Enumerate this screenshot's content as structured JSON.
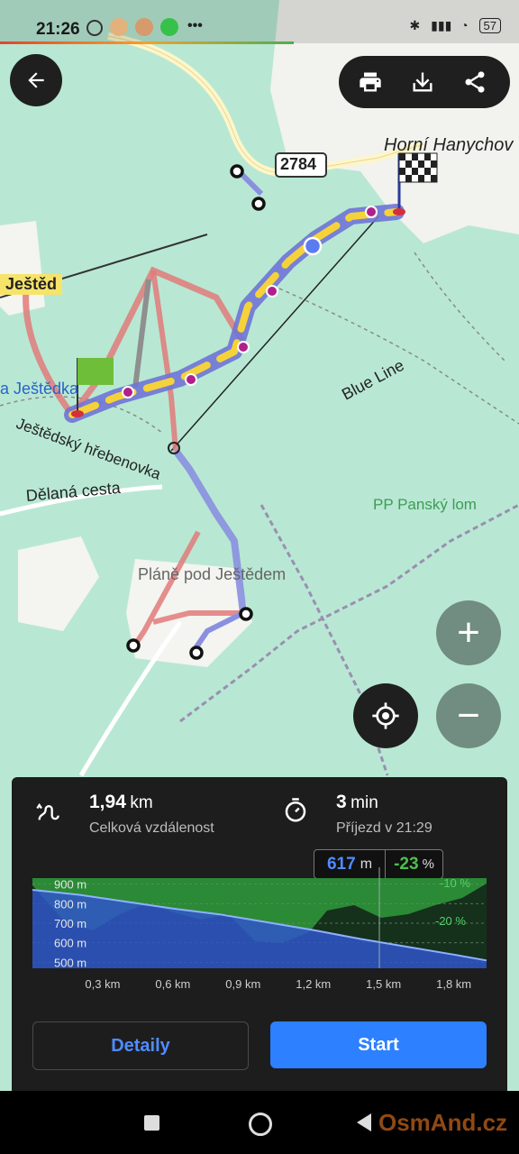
{
  "status_bar": {
    "time": "21:26",
    "more": "•••",
    "battery": "57"
  },
  "map": {
    "labels": {
      "town": "Horní Hanychov",
      "road_number": "2784",
      "peak": "Ještěd",
      "peak_hut": "a Ještědka",
      "ridge": "Ještědský hřebenovka",
      "cableway": "Blue Line",
      "road": "Dělaná cesta",
      "reserve": "PP Panský lom",
      "area": "Pláně pod Ještědem"
    },
    "icons": {
      "back": "back-arrow-icon",
      "print": "print-icon",
      "download": "download-icon",
      "share": "share-icon",
      "locate": "my-location-icon"
    },
    "zoom_in": "+",
    "zoom_out": "−"
  },
  "route_panel": {
    "distance_value": "1,94",
    "distance_unit": "km",
    "distance_label": "Celková vzdálenost",
    "time_value": "3",
    "time_unit": "min",
    "arrival_label": "Příjezd v 21:29",
    "cursor_alt_value": "617",
    "cursor_alt_unit": "m",
    "cursor_slope_value": "-23",
    "cursor_slope_unit": "%",
    "detail_button": "Detaily",
    "start_button": "Start"
  },
  "chart_data": {
    "type": "area",
    "y_ticks": [
      "900 m",
      "800 m",
      "700 m",
      "600 m",
      "500 m"
    ],
    "x_ticks": [
      "0,3 km",
      "0,6 km",
      "0,9 km",
      "1,2 km",
      "1,5 km",
      "1,8 km"
    ],
    "slope_ticks": [
      "-10 %",
      "-20 %"
    ],
    "ylim": [
      470,
      930
    ],
    "xlim": [
      0,
      1.94
    ],
    "elevation": {
      "x": [
        0,
        0.2,
        0.4,
        0.6,
        0.8,
        1.0,
        1.2,
        1.4,
        1.6,
        1.8,
        1.94
      ],
      "y": [
        870,
        845,
        810,
        775,
        745,
        705,
        665,
        620,
        580,
        540,
        510
      ]
    },
    "colors": {
      "elevation": "#2f55c9",
      "slope": "#2e9a3a",
      "accent": "#2d80ff"
    },
    "grid": true
  },
  "nav_bar": {
    "watermark": "OsmAnd.cz"
  }
}
